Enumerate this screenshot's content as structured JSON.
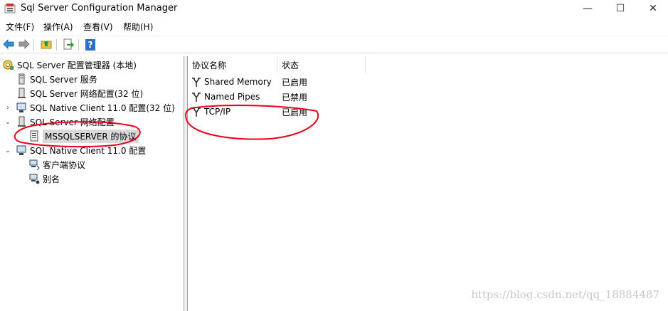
{
  "window": {
    "title": "Sql Server Configuration Manager",
    "minimize_symbol": "—",
    "maximize_symbol": "☐",
    "close_symbol": "✕"
  },
  "menu": [
    {
      "label": "文件(F)"
    },
    {
      "label": "操作(A)"
    },
    {
      "label": "查看(V)"
    },
    {
      "label": "帮助(H)"
    }
  ],
  "toolbar": {
    "buttons": [
      "back-arrow-icon",
      "forward-arrow-icon",
      "up-folder-icon",
      "export-list-icon",
      "help-icon"
    ],
    "help_glyph": "?"
  },
  "tree": {
    "root": "SQL Server 配置管理器 (本地)",
    "items": [
      {
        "label": "SQL Server 服务"
      },
      {
        "label": "SQL Server 网络配置(32 位)"
      },
      {
        "label": "SQL Native Client 11.0 配置(32 位)"
      },
      {
        "label": "SQL Server 网络配置"
      },
      {
        "label": "MSSQLSERVER 的协议"
      },
      {
        "label": "SQL Native Client 11.0 配置"
      },
      {
        "label": "客户端协议"
      },
      {
        "label": "别名"
      }
    ],
    "expander_collapsed": "›",
    "expander_expanded": "⌄"
  },
  "list": {
    "columns": [
      "协议名称",
      "状态"
    ],
    "rows": [
      {
        "name": "Shared Memory",
        "status": "已启用"
      },
      {
        "name": "Named Pipes",
        "status": "已禁用"
      },
      {
        "name": "TCP/IP",
        "status": "已启用"
      }
    ]
  },
  "watermark": "https://blog.csdn.net/qq_18884487",
  "colors": {
    "annotation_red": "#e8001c",
    "selection": "#d9d9d9",
    "pane_border": "#a0a0a0"
  }
}
